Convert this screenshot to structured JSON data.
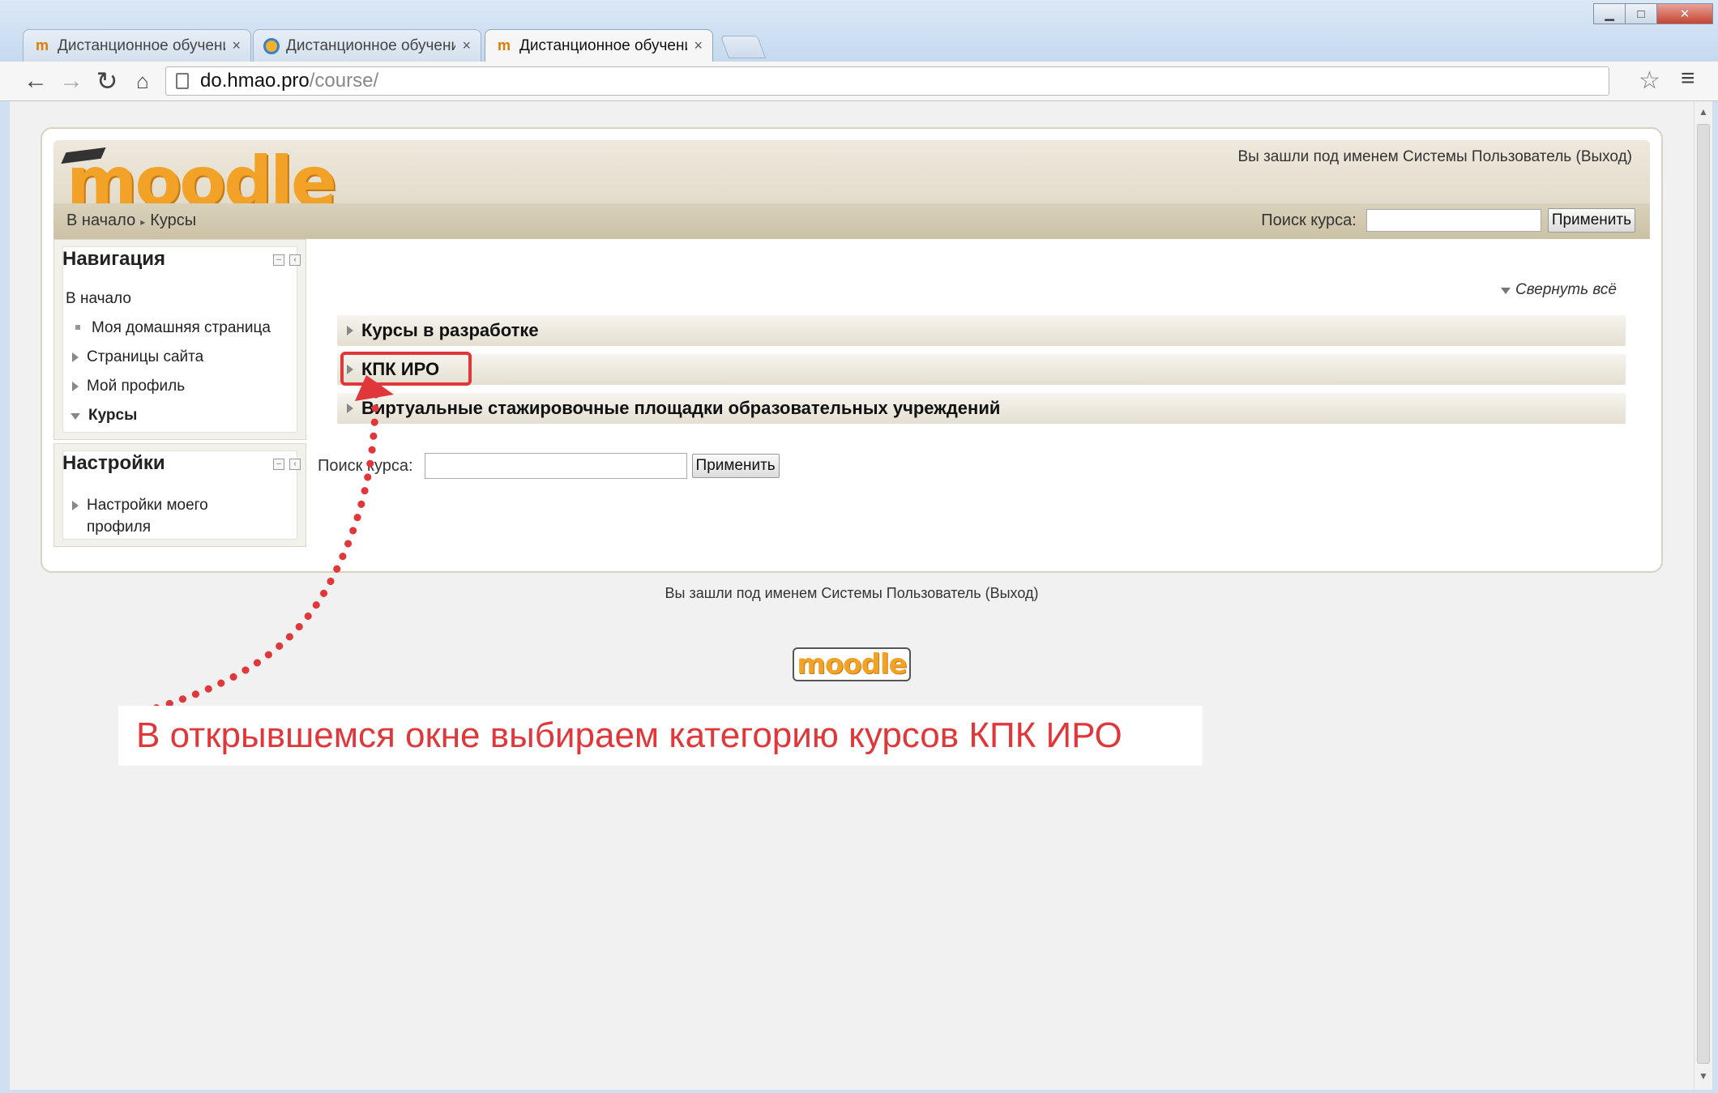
{
  "browser": {
    "tabs": [
      {
        "title": "Дистанционное обучени",
        "icon": "moodle-favicon-icon"
      },
      {
        "title": "Дистанционное обучени",
        "icon": "globe-favicon-icon"
      },
      {
        "title": "Дистанционное обучени",
        "icon": "moodle-favicon-icon"
      }
    ],
    "tab_close": "×",
    "url_host": "do.hmao.pro",
    "url_path": "/course/"
  },
  "moodle": {
    "logo": "moodle",
    "header_login": "Вы зашли под именем Системы Пользователь (Выход)",
    "breadcrumb": {
      "home": "В начало",
      "current": "Курсы"
    },
    "header_search": {
      "label": "Поиск курса:",
      "button": "Применить"
    },
    "navigation_block": {
      "title": "Навигация",
      "items": [
        {
          "label": "В начало"
        },
        {
          "label": "Моя домашняя страница"
        },
        {
          "label": "Страницы сайта"
        },
        {
          "label": "Мой профиль"
        },
        {
          "label": "Курсы"
        }
      ]
    },
    "settings_block": {
      "title": "Настройки",
      "items": [
        {
          "label": "Настройки моего профиля"
        }
      ]
    },
    "collapse_all": "Свернуть всё",
    "categories": [
      {
        "label": "Курсы в разработке"
      },
      {
        "label": "КПК ИРО"
      },
      {
        "label": "Виртуальные стажировочные площадки образовательных учреждений"
      }
    ],
    "main_search": {
      "label": "Поиск курса:",
      "button": "Применить"
    },
    "footer_login": "Вы зашли под именем Системы Пользователь (Выход)",
    "footer_logo": "moodle"
  },
  "annotation": {
    "text": "В открывшемся окне выбираем категорию курсов КПК ИРО",
    "color": "#e0373a"
  }
}
